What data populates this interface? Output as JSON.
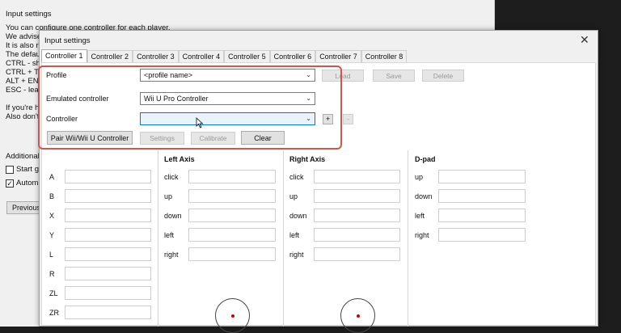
{
  "background_window": {
    "title": "Input settings",
    "lines": [
      "You can configure one controller for each player.",
      "We advise",
      "It is also re",
      "The defaul",
      "CTRL - sho",
      "CTRL + TAE",
      "ALT + ENT",
      "ESC - leave",
      "",
      "If you're ha",
      "Also don't"
    ],
    "additional": "Additional",
    "start_game": "Start ga",
    "automatic": "Automa",
    "previous": "Previous"
  },
  "dialog": {
    "title": "Input settings",
    "close": "✕",
    "tabs": [
      "Controller 1",
      "Controller 2",
      "Controller 3",
      "Controller 4",
      "Controller 5",
      "Controller 6",
      "Controller 7",
      "Controller 8"
    ],
    "profile_label": "Profile",
    "profile_value": "<profile name>",
    "load": "Load",
    "save": "Save",
    "delete": "Delete",
    "emulated_label": "Emulated controller",
    "emulated_value": "Wii U Pro Controller",
    "controller_label": "Controller",
    "controller_value": "",
    "plus": "+",
    "minus": "-",
    "pair": "Pair Wii/Wii U Controller",
    "settings": "Settings",
    "calibrate": "Calibrate",
    "clear": "Clear",
    "buttons": [
      "A",
      "B",
      "X",
      "Y",
      "L",
      "R",
      "ZL",
      "ZR"
    ],
    "left_axis": {
      "title": "Left Axis",
      "rows": [
        "click",
        "up",
        "down",
        "left",
        "right"
      ]
    },
    "right_axis": {
      "title": "Right Axis",
      "rows": [
        "click",
        "up",
        "down",
        "left",
        "right"
      ]
    },
    "dpad": {
      "title": "D-pad",
      "rows": [
        "up",
        "down",
        "left",
        "right"
      ]
    }
  },
  "colors": {
    "highlight": "#d3544a",
    "accent": "#0078d7",
    "stick_dot": "#cc0000"
  }
}
